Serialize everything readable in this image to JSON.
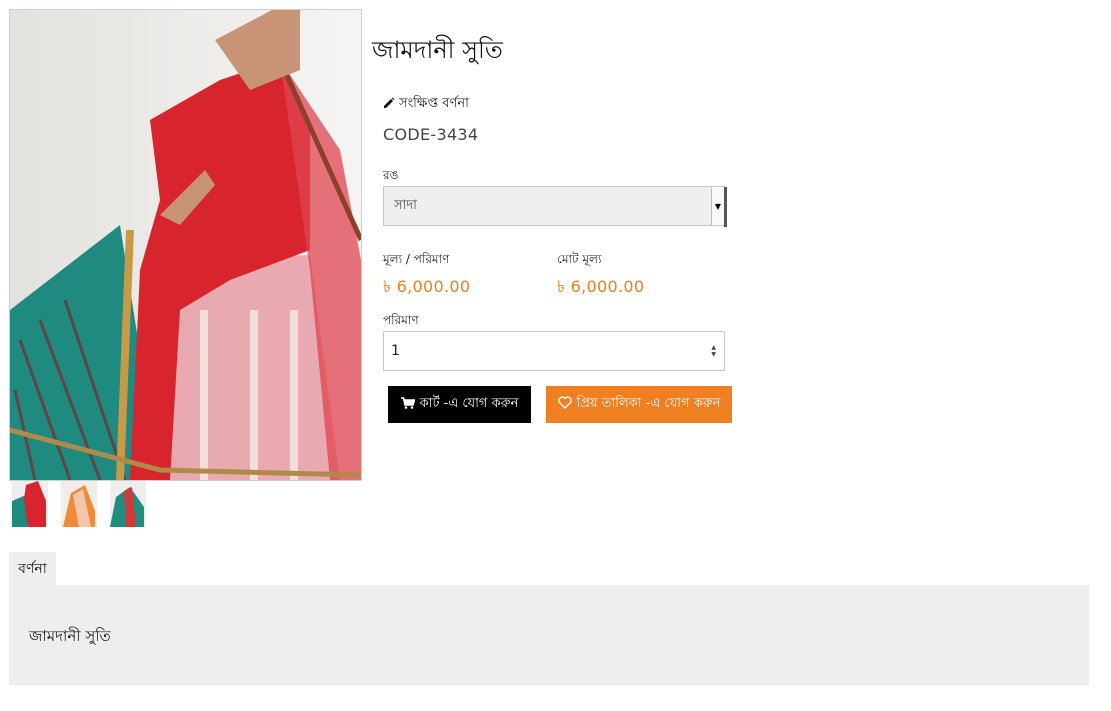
{
  "product": {
    "title": "জামদানী সুতি",
    "short_description_label": "সংক্ষিপ্ত বর্ণনা",
    "code": "CODE-3434"
  },
  "color": {
    "label": "রঙ",
    "selected": "সাদা"
  },
  "pricing": {
    "unit_price_label": "মূল্য / পরিমাণ",
    "unit_price": "৳ 6,000.00",
    "total_price_label": "মোট মূল্য",
    "total_price": "৳ 6,000.00",
    "price_color": "#ef7f1a"
  },
  "quantity": {
    "label": "পরিমাণ",
    "value": "1"
  },
  "actions": {
    "cart_label": "কার্ট -এ যোগ করুন",
    "wishlist_label": "প্রিয় তালিকা -এ যোগ করুন"
  },
  "tabs": {
    "description_label": "বর্ণনা",
    "description_text": "জামদানী সুতি"
  },
  "icons": {
    "short_desc": "pencil-icon",
    "cart": "cart-icon",
    "wishlist": "heart-icon"
  },
  "colors": {
    "cart_button": "#000000",
    "wishlist_button": "#f07f22",
    "tab_background": "#eeeeee"
  }
}
